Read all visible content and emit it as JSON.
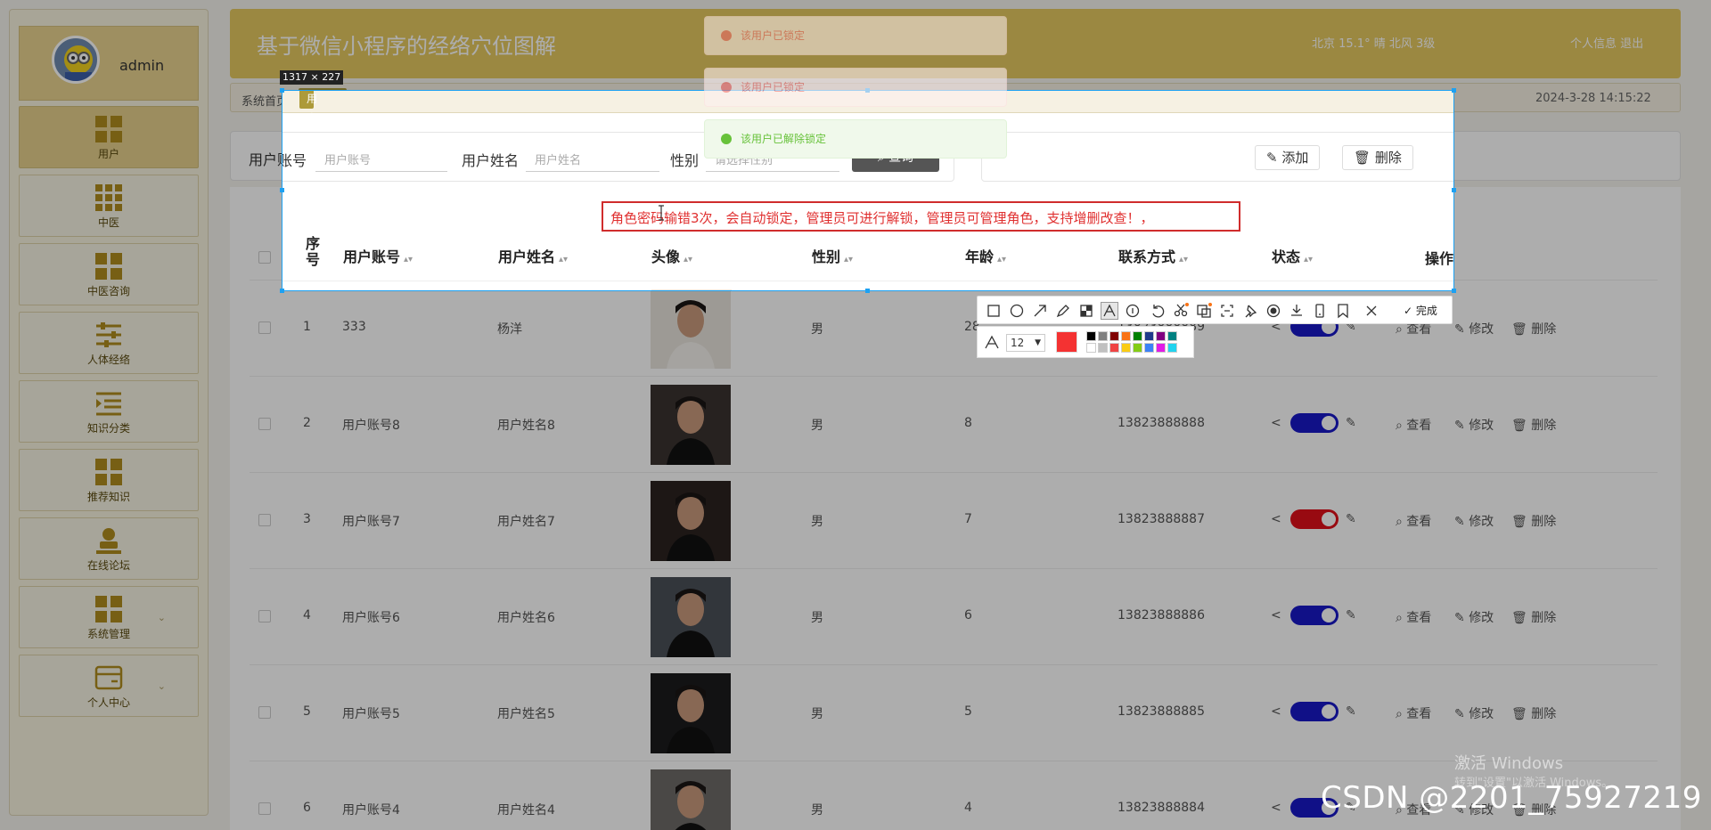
{
  "sidebar": {
    "username": "admin",
    "items": [
      {
        "label": "用户",
        "icon": "grid-icon"
      },
      {
        "label": "中医",
        "icon": "grid9-icon"
      },
      {
        "label": "中医咨询",
        "icon": "grid-icon"
      },
      {
        "label": "人体经络",
        "icon": "sliders-icon"
      },
      {
        "label": "知识分类",
        "icon": "list-icon"
      },
      {
        "label": "推荐知识",
        "icon": "grid-icon"
      },
      {
        "label": "在线论坛",
        "icon": "person-icon"
      },
      {
        "label": "系统管理",
        "icon": "grid-icon"
      },
      {
        "label": "个人中心",
        "icon": "card-icon"
      }
    ]
  },
  "header": {
    "title": "基于微信小程序的经络穴位图解",
    "weather": "北京 15.1° 晴 北风 3级",
    "user_links": "个人信息 退出"
  },
  "breadcrumb": {
    "home": "系统首页",
    "tag": "用户 ×",
    "datetime": "2024-3-28 14:15:22"
  },
  "filter": {
    "account_label": "用户账号",
    "account_placeholder": "用户账号",
    "name_label": "用户姓名",
    "name_placeholder": "用户姓名",
    "gender_label": "性别",
    "gender_placeholder": "请选择性别",
    "search_label": "查询"
  },
  "actions": {
    "add_label": "添加",
    "delete_label": "删除"
  },
  "table": {
    "columns": [
      "序号",
      "用户账号",
      "用户姓名",
      "头像",
      "性别",
      "年龄",
      "联系方式",
      "状态",
      "操作"
    ],
    "rows": [
      {
        "idx": "1",
        "account": "333",
        "name": "杨洋",
        "gender": "男",
        "age": "28",
        "phone": "13823888889",
        "locked": false
      },
      {
        "idx": "2",
        "account": "用户账号8",
        "name": "用户姓名8",
        "gender": "男",
        "age": "8",
        "phone": "13823888888",
        "locked": false
      },
      {
        "idx": "3",
        "account": "用户账号7",
        "name": "用户姓名7",
        "gender": "男",
        "age": "7",
        "phone": "13823888887",
        "locked": true
      },
      {
        "idx": "4",
        "account": "用户账号6",
        "name": "用户姓名6",
        "gender": "男",
        "age": "6",
        "phone": "13823888886",
        "locked": false
      },
      {
        "idx": "5",
        "account": "用户账号5",
        "name": "用户姓名5",
        "gender": "男",
        "age": "5",
        "phone": "13823888885",
        "locked": false
      },
      {
        "idx": "6",
        "account": "用户账号4",
        "name": "用户姓名4",
        "gender": "男",
        "age": "4",
        "phone": "13823888884",
        "locked": false
      }
    ],
    "row_actions": {
      "view": "查看",
      "edit": "修改",
      "delete": "删除"
    }
  },
  "toasts": [
    {
      "text": "该用户已锁定",
      "type": "error"
    },
    {
      "text": "该用户已锁定",
      "type": "error"
    },
    {
      "text": "该用户已解除锁定",
      "type": "success"
    }
  ],
  "screenshot_tool": {
    "size_label": "1317 × 227",
    "annotation_text": "角色密码输错3次，会自动锁定，管理员可进行解锁，管理员可管理角色，支持增删改查！，",
    "done_label": "完成",
    "font_size": "12",
    "current_color": "#f43232",
    "palette": [
      "#000000",
      "#808080",
      "#800000",
      "#f97316",
      "#008000",
      "#1e3a8a",
      "#800080",
      "#008080",
      "#ffffff",
      "#c0c0c0",
      "#ef4444",
      "#facc15",
      "#84cc16",
      "#3b82f6",
      "#e11ce6",
      "#22d3ee"
    ]
  },
  "watermarks": {
    "windows_line1": "激活 Windows",
    "windows_line2": "转到\"设置\"以激活 Windows。",
    "csdn": "CSDN @2201_75927219"
  },
  "colors": {
    "header_bg": "#e5c960",
    "toggle_on": "#1818c8",
    "toggle_locked": "#e0101a",
    "selection_border": "#1da1f2",
    "annotation_red": "#d02c2c"
  }
}
